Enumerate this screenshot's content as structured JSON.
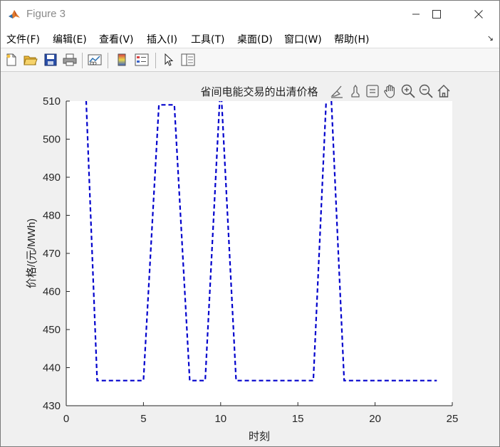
{
  "window": {
    "title": "Figure 3",
    "minimize_glyph": "—",
    "maximize_glyph": "☐",
    "close_glyph": "✕"
  },
  "menu": {
    "items": [
      "文件(F)",
      "编辑(E)",
      "查看(V)",
      "插入(I)",
      "工具(T)",
      "桌面(D)",
      "窗口(W)",
      "帮助(H)"
    ],
    "overflow_glyph": "↘"
  },
  "toolbar": {
    "icons": [
      "new-figure-icon",
      "open-file-icon",
      "save-icon",
      "print-icon",
      "link-plot-icon",
      "colorbar-icon",
      "legend-icon",
      "pointer-icon",
      "property-inspector-icon"
    ]
  },
  "axes_toolbar": {
    "icons": [
      "brush-icon",
      "data-tip-icon",
      "rotate-icon",
      "pan-icon",
      "zoom-in-icon",
      "zoom-out-icon",
      "home-icon"
    ]
  },
  "chart_data": {
    "type": "line",
    "title": "省间电能交易的出清价格",
    "xlabel": "时刻",
    "ylabel": "价格/(元/MWh)",
    "xlim": [
      0,
      25
    ],
    "ylim": [
      430,
      510
    ],
    "xticks": [
      0,
      5,
      10,
      15,
      20,
      25
    ],
    "yticks": [
      430,
      440,
      450,
      460,
      470,
      480,
      490,
      500,
      510
    ],
    "grid": false,
    "series": [
      {
        "line_style": "dashed",
        "color": "#0000cc",
        "x": [
          1,
          2,
          3,
          4,
          5,
          6,
          7,
          8,
          9,
          10,
          11,
          12,
          13,
          14,
          15,
          16,
          17,
          18,
          19,
          20,
          21,
          22,
          23,
          24
        ],
        "y": [
          540,
          436.6,
          436.6,
          436.6,
          436.6,
          509,
          509,
          436.6,
          436.6,
          515,
          436.6,
          436.6,
          436.6,
          436.6,
          436.6,
          436.6,
          525,
          436.6,
          436.6,
          436.6,
          436.6,
          436.6,
          436.6,
          436.6
        ]
      }
    ]
  }
}
